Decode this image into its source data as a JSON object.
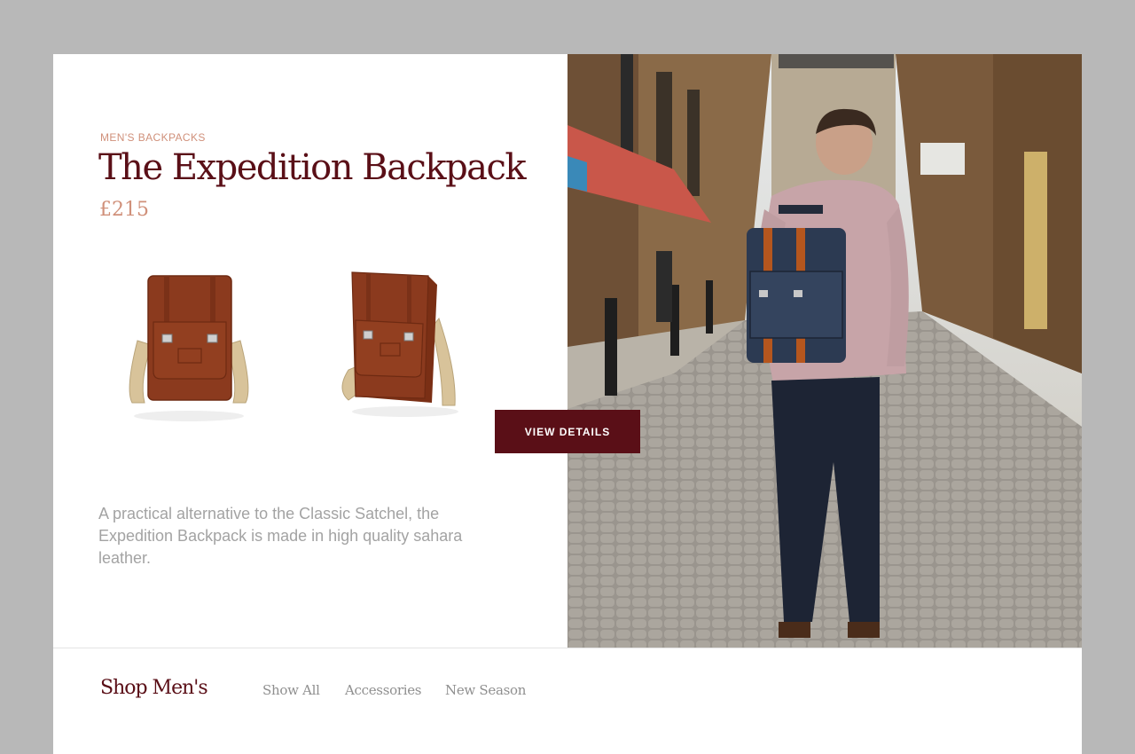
{
  "product": {
    "category": "MEN'S BACKPACKS",
    "title": "The Expedition Backpack",
    "price": "£215",
    "description": "A practical alternative to the Classic Satchel, the Expedition Backpack is made in high quality sahara leather.",
    "cta_label": "VIEW DETAILS"
  },
  "images": {
    "front": "brown-leather-backpack-front",
    "angle": "brown-leather-backpack-angle",
    "lifestyle": "man-wearing-navy-backpack-on-cobblestone-street"
  },
  "footer": {
    "title": "Shop Men's",
    "links": [
      "Show All",
      "Accessories",
      "New Season"
    ]
  },
  "colors": {
    "brand": "#5a0f17",
    "accent": "#d0907a",
    "body_text": "#a3a3a3",
    "leather": "#8b3a1e",
    "strap": "#d8c39a"
  }
}
